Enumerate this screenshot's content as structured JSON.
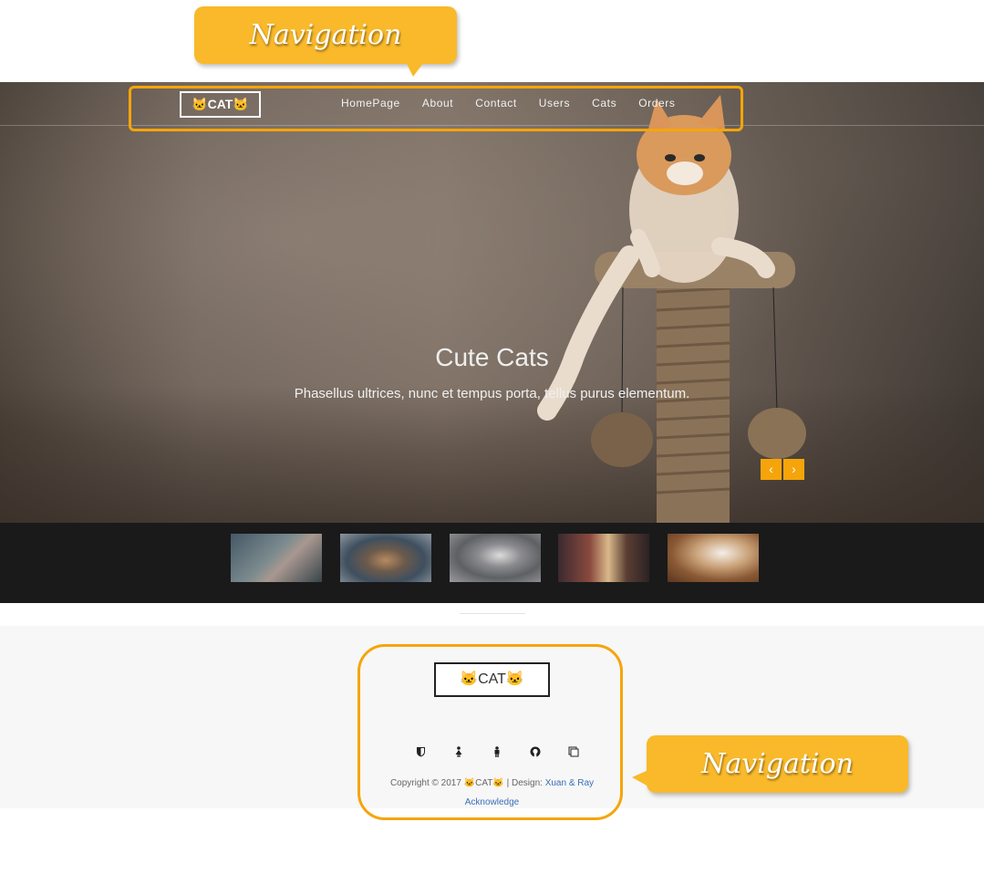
{
  "callouts": {
    "top_label": "Navigation",
    "bottom_label": "Navigation"
  },
  "nav": {
    "logo": "🐱CAT🐱",
    "links": [
      "HomePage",
      "About",
      "Contact",
      "Users",
      "Cats",
      "Orders"
    ]
  },
  "hero": {
    "title": "Cute Cats",
    "subtitle": "Phasellus ultrices, nunc et tempus porta, tellus purus elementum.",
    "prev": "‹",
    "next": "›"
  },
  "thumbnails": [
    "cat-thumbnail-1",
    "cat-thumbnail-2",
    "cat-thumbnail-3",
    "cat-thumbnail-4",
    "cat-thumbnail-5"
  ],
  "footer": {
    "logo": "🐱CAT🐱",
    "social_icons": [
      "shield-icon",
      "person-icon",
      "person-icon",
      "github-icon",
      "copy-icon"
    ],
    "copyright_prefix": "Copyright © 2017 🐱CAT🐱 | Design: ",
    "designer_link": "Xuan & Ray",
    "acknowledge_link": "Acknowledge"
  },
  "colors": {
    "accent": "#f5a50a",
    "callout": "#f9b92a",
    "link": "#3b6fb6"
  }
}
